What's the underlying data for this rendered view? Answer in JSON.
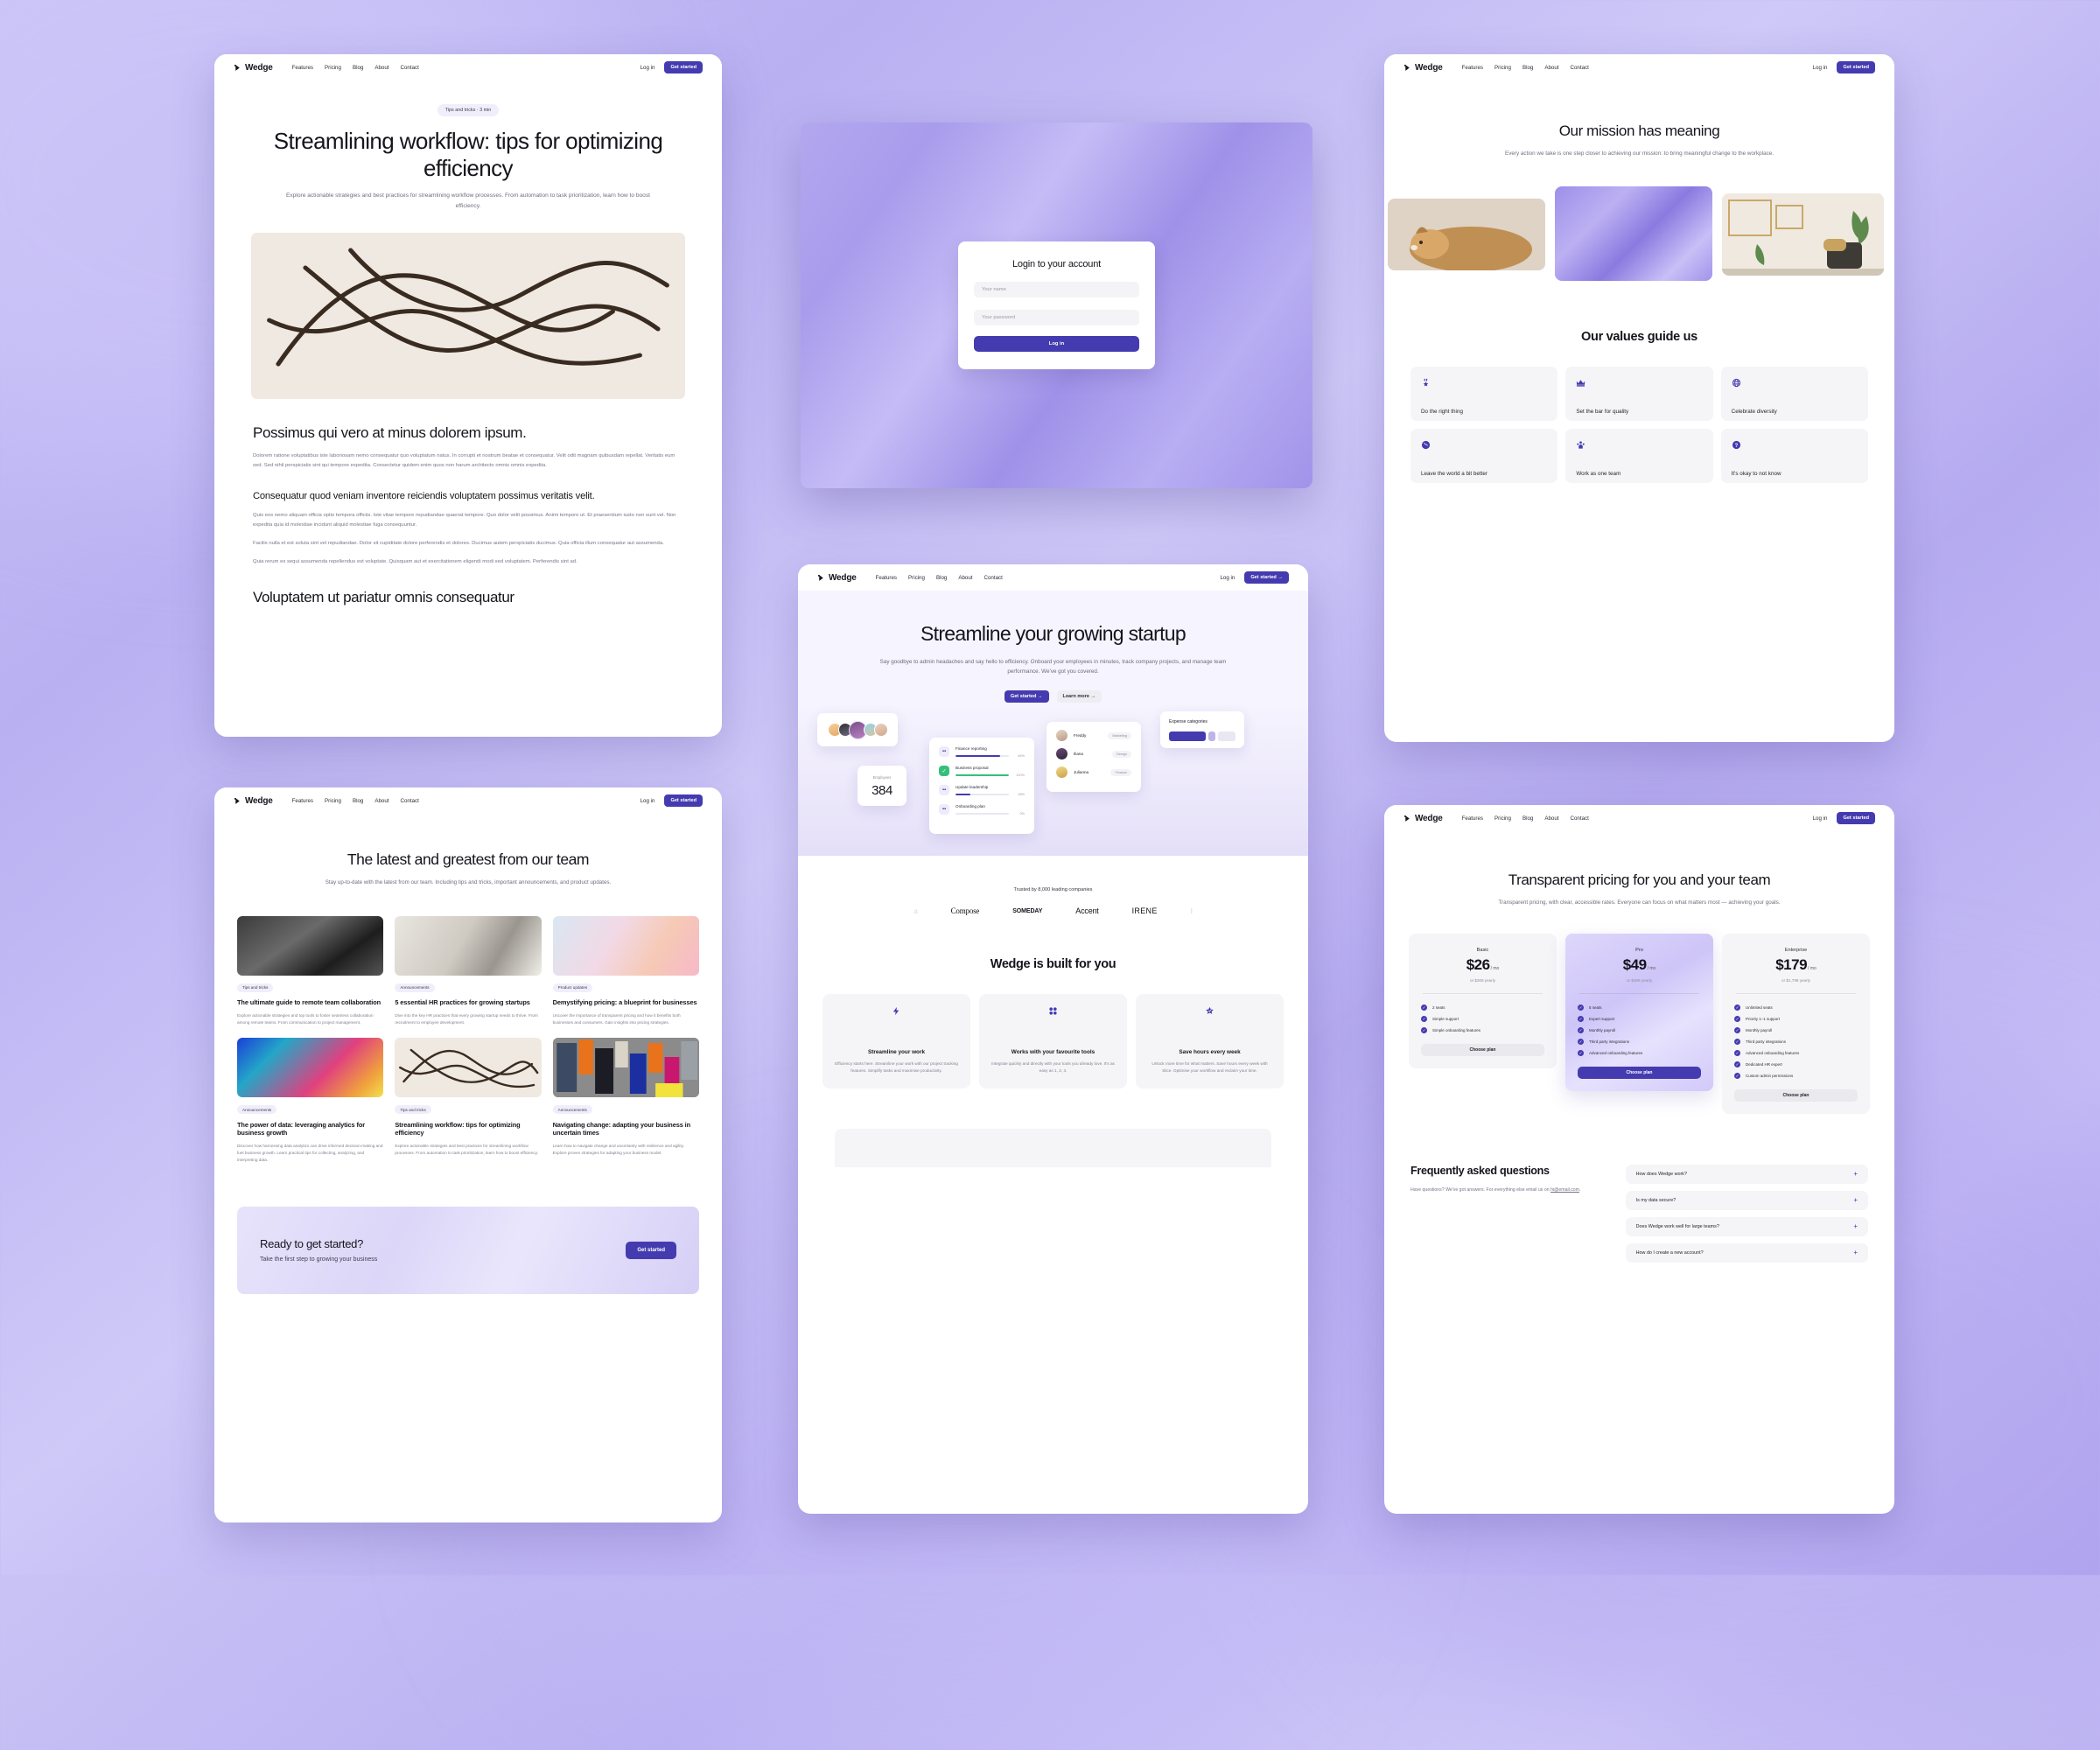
{
  "brand": {
    "name": "Wedge"
  },
  "nav": {
    "links": [
      "Features",
      "Pricing",
      "Blog",
      "About",
      "Contact"
    ],
    "login": "Log in",
    "cta": "Get started",
    "cta_arrow": "Get started  →"
  },
  "article": {
    "pill": "Tips and tricks  ·  3 min",
    "title": "Streamlining workflow: tips for optimizing efficiency",
    "subtitle": "Explore actionable strategies and best practices for streamlining workflow processes. From automation to task prioritization, learn how to boost efficiency.",
    "h2": "Possimus qui vero at minus dolorem ipsum.",
    "p1": "Dolorem ratione voluptatibus iste laboriosam nemo consequatur quo voluptatum natus. In corrupti et nostrum beatae et consequatur. Velit odit magnam quibusdam repellat. Veritatis eum sed. Sed nihil perspiciatis sint qui tempore expedita. Consectetur quidem enim quos non harum architecto omnis omnis expedita.",
    "h3": "Consequatur quod veniam inventore reiciendis voluptatem possimus veritatis velit.",
    "p2": "Quis eos nemo aliquam officia optio tempora officiis. Iste vitae tempore repudiandae quaerat tempore. Quo dolor velit possimus. Animi tempore ut. Et praesentium iusto non sunt vel. Non expedita quia id molestiae incidunt aliquid molestiae fuga consequuntur.",
    "p3": "Facilis nulla et est soluta sint vel repudiandae. Dolor sit cupiditate dolore perferendis et dolores. Ducimus autem perspiciatis ducimus. Quia officia illum consequatur aut assumenda.",
    "p4": "Quia rerum ex sequi assumenda repellendus est voluptate. Quisquam aut et exercitationem eligendi modi sed voluptatem. Perferendis sint ad.",
    "h2b": "Voluptatem ut pariatur omnis consequatur"
  },
  "login": {
    "title": "Login to your account",
    "name_placeholder": "Your name",
    "password_placeholder": "Your password",
    "button": "Log in"
  },
  "about": {
    "title": "Our mission has meaning",
    "subtitle": "Every action we take is one step closer to achieving our mission: to bring meaningful change to the workplace.",
    "values_title": "Our values guide us",
    "values": [
      {
        "icon": "medal-icon",
        "glyph": "🎖",
        "label": "Do the right thing"
      },
      {
        "icon": "crown-icon",
        "glyph": "♛",
        "label": "Set the bar for quality"
      },
      {
        "icon": "globe-grid-icon",
        "glyph": "✺",
        "label": "Celebrate diversity"
      },
      {
        "icon": "earth-icon",
        "glyph": "🌍",
        "label": "Leave the world a bit better"
      },
      {
        "icon": "people-icon",
        "glyph": "👥",
        "label": "Work as one team"
      },
      {
        "icon": "question-icon",
        "glyph": "?",
        "label": "It's okay to not know"
      }
    ]
  },
  "blog": {
    "title": "The latest and greatest from our team",
    "subtitle": "Stay up-to-date with the latest from our team. Including tips and tricks, important announcements, and product updates.",
    "posts": [
      {
        "tag": "Tips and tricks",
        "title": "The ultimate guide to remote team collaboration",
        "desc": "Explore actionable strategies and top tools to foster seamless collaboration among remote teams. From communication to project management."
      },
      {
        "tag": "Announcements",
        "title": "5 essential HR practices for growing startups",
        "desc": "Dive into the key HR practices that every growing startup needs to thrive. From recruitment to employee development."
      },
      {
        "tag": "Product updates",
        "title": "Demystifying pricing: a blueprint for businesses",
        "desc": "Uncover the importance of transparent pricing and how it benefits both businesses and consumers. Gain insights into pricing strategies."
      },
      {
        "tag": "Announcements",
        "title": "The power of data: leveraging analytics for business growth",
        "desc": "Discover how harnessing data analytics can drive informed decision-making and fuel business growth. Learn practical tips for collecting, analyzing, and interpreting data."
      },
      {
        "tag": "Tips and tricks",
        "title": "Streamlining workflow: tips for optimizing efficiency",
        "desc": "Explore actionable strategies and best practices for streamlining workflow processes. From automation to task prioritization, learn how to boost efficiency."
      },
      {
        "tag": "Announcements",
        "title": "Navigating change: adapting your business in uncertain times",
        "desc": "Learn how to navigate change and uncertainty with resilience and agility. Explore proven strategies for adapting your business model."
      }
    ],
    "cta_title": "Ready to get started?",
    "cta_sub": "Take the first step to growing your business",
    "cta_button": "Get started"
  },
  "landing": {
    "hero_title": "Streamline your growing startup",
    "hero_sub": "Say goodbye to admin headaches and say hello to efficiency. Onboard your employees in minutes, track company projects, and manage team performance. We've got you covered.",
    "cta_primary": "Get started  →",
    "cta_secondary": "Learn more  →",
    "widgets": {
      "employees_label": "Employees",
      "employees_value": "384",
      "tasks": [
        {
          "name": "Finance reporting",
          "pct": "84%",
          "value": 84,
          "done": false
        },
        {
          "name": "Business proposal",
          "pct": "100%",
          "value": 100,
          "done": true
        },
        {
          "name": "Update leadership",
          "pct": "28%",
          "value": 28,
          "done": false
        },
        {
          "name": "Onboarding plan",
          "pct": "0%",
          "value": 0,
          "done": false
        }
      ],
      "people": [
        {
          "name": "Freddy",
          "role": "Marketing"
        },
        {
          "name": "Iliana",
          "role": "Design"
        },
        {
          "name": "Julianna",
          "role": "Finance"
        }
      ],
      "expense_title": "Expense categories"
    },
    "trust_label": "Trusted by 8,000 leading companies",
    "logos": [
      "a",
      "Compose",
      "SOMEDAY",
      "Accent",
      "IRENE",
      "I"
    ],
    "features_title": "Wedge is built for you",
    "features": [
      {
        "icon": "bolt-icon",
        "glyph": "⚡",
        "name": "Streamline your work",
        "desc": "Efficiency starts here. Streamline your work with our project tracking features. Simplify tasks and maximise productivity."
      },
      {
        "icon": "grid-icon",
        "glyph": "▪▪",
        "name": "Works with your favourite tools",
        "desc": "Integrate quickly and directly with your tools you already love. It's as easy as 1, 2, 3."
      },
      {
        "icon": "star-badge-icon",
        "glyph": "★",
        "name": "Save hours every week",
        "desc": "Unlock more time for what matters. Save hours every week with Slice. Optimise your workflow and reclaim your time."
      }
    ]
  },
  "pricing": {
    "title": "Transparent pricing for you and your team",
    "subtitle": "Transparent pricing, with clear, accessible rates. Everyone can focus on what matters most — achieving your goals.",
    "plans": [
      {
        "name": "Basic",
        "amount": "$26",
        "per": "/ mo",
        "yearly": "or $269 yearly",
        "features": [
          "2 seats",
          "Simple support",
          "Simple onboarding features"
        ],
        "button": "Choose plan",
        "featured": false
      },
      {
        "name": "Pro",
        "amount": "$49",
        "per": "/ mo",
        "yearly": "or $499 yearly",
        "features": [
          "5 seats",
          "Expert support",
          "Monthly payroll",
          "Third party integrations",
          "Advanced onboarding features"
        ],
        "button": "Choose plan",
        "featured": true
      },
      {
        "name": "Enterprise",
        "amount": "$179",
        "per": "/ mo",
        "yearly": "or $1,799 yearly",
        "features": [
          "Unlimited seats",
          "Priority 1–1 support",
          "Monthly payroll",
          "Third party integrations",
          "Advanced onboarding features",
          "Dedicated HR expert",
          "Custom admin permissions"
        ],
        "button": "Choose plan",
        "featured": false
      }
    ],
    "faq_title": "Frequently asked questions",
    "faq_intro_before": "Have questions? We've got answers. For everything else email us on ",
    "faq_email": "hi@email.com",
    "faq_intro_after": ".",
    "faqs": [
      "How does Wedge work?",
      "Is my data secure?",
      "Does Wedge work well for large teams?",
      "How do I create a new account?"
    ]
  },
  "colors": {
    "accent": "#453bb0",
    "surface": "#f5f5f8",
    "pill": "#f0eefb",
    "success": "#35c07a"
  }
}
